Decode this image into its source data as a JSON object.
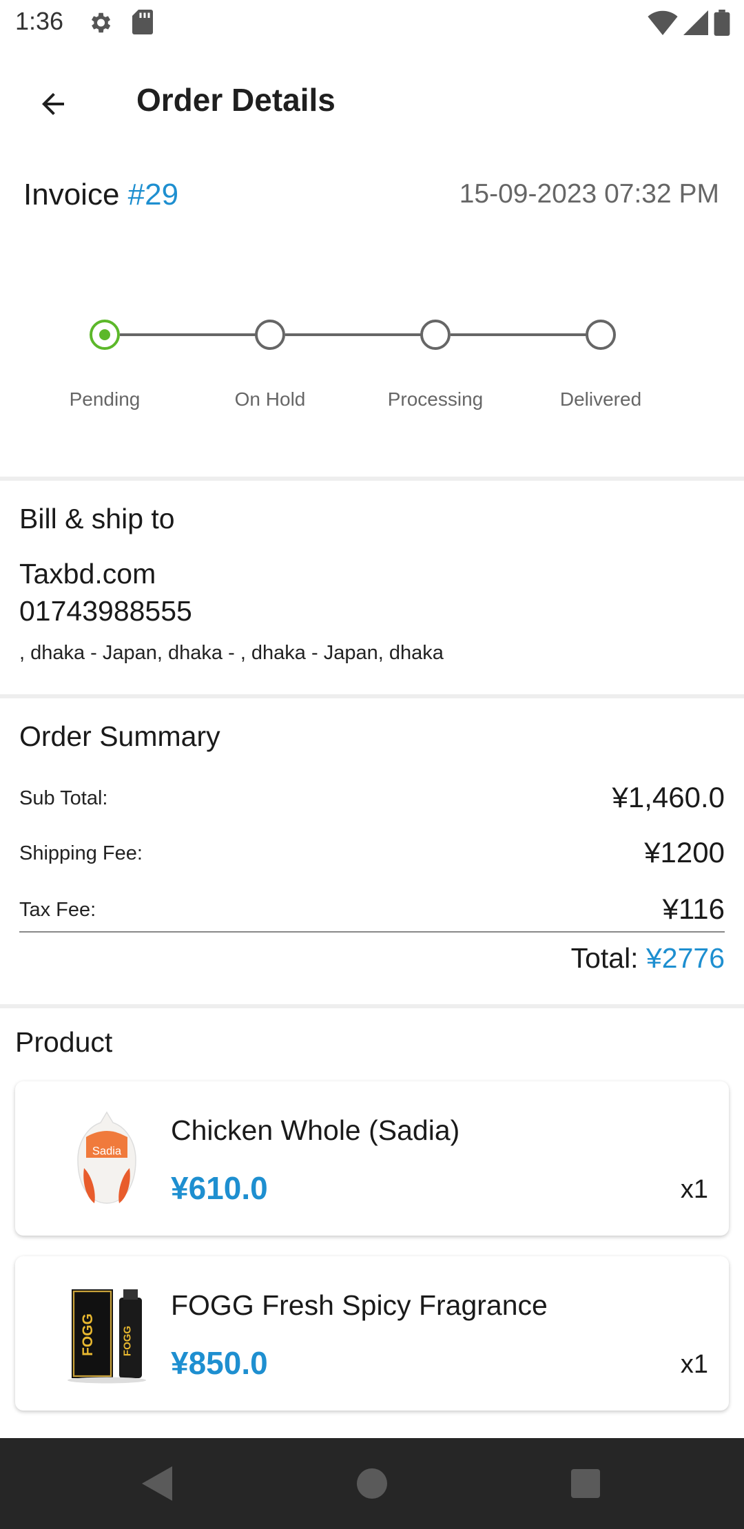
{
  "status_bar": {
    "time": "1:36"
  },
  "header": {
    "title": "Order Details"
  },
  "invoice": {
    "label": "Invoice",
    "number": "#29",
    "date": "15-09-2023 07:32 PM"
  },
  "stepper": {
    "steps": [
      {
        "label": "Pending",
        "active": true
      },
      {
        "label": "On Hold",
        "active": false
      },
      {
        "label": "Processing",
        "active": false
      },
      {
        "label": "Delivered",
        "active": false
      }
    ],
    "active_color": "#5cb82a"
  },
  "bill": {
    "title": "Bill & ship to",
    "name": "Taxbd.com",
    "phone": "01743988555",
    "address": ", dhaka - Japan, dhaka - , dhaka - Japan, dhaka"
  },
  "summary": {
    "title": "Order Summary",
    "rows": [
      {
        "label": "Sub Total:",
        "value": "¥1,460.0"
      },
      {
        "label": "Shipping Fee:",
        "value": "¥1200"
      },
      {
        "label": "Tax Fee:",
        "value": "¥116"
      }
    ],
    "total_label": "Total:",
    "total_value": "¥2776"
  },
  "products": {
    "title": "Product",
    "items": [
      {
        "name": "Chicken Whole (Sadia)",
        "price": "¥610.0",
        "qty": "x1",
        "image_icon": "chicken-package-image",
        "image_text": "Sadia"
      },
      {
        "name": "FOGG Fresh Spicy Fragrance",
        "price": "¥850.0",
        "qty": "x1",
        "image_icon": "fogg-bottle-image",
        "image_text": "FOGG"
      }
    ]
  },
  "colors": {
    "accent": "#1e8fd0",
    "nav_bar": "#262626"
  }
}
